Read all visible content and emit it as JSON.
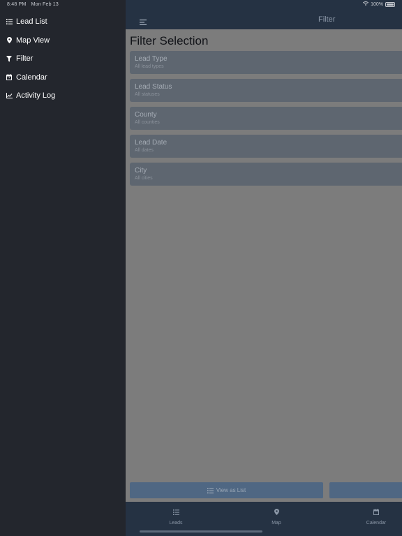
{
  "status_bar": {
    "time": "8:48 PM",
    "date": "Mon Feb 13",
    "battery": "100%"
  },
  "sidebar": {
    "items": [
      {
        "label": "Lead List",
        "icon": "list-icon"
      },
      {
        "label": "Map View",
        "icon": "map-pin-icon"
      },
      {
        "label": "Filter",
        "icon": "funnel-icon"
      },
      {
        "label": "Calendar",
        "icon": "calendar-icon"
      },
      {
        "label": "Activity Log",
        "icon": "line-chart-icon"
      }
    ]
  },
  "navbar": {
    "title": "Filter",
    "menu_icon": "hamburger-icon"
  },
  "main": {
    "page_title": "Filter Selection",
    "filters": [
      {
        "title": "Lead Type",
        "value": "All lead types"
      },
      {
        "title": "Lead Status",
        "value": "All statuses"
      },
      {
        "title": "County",
        "value": "All counties"
      },
      {
        "title": "Lead Date",
        "value": "All dates"
      },
      {
        "title": "City",
        "value": "All cities"
      }
    ],
    "view_list_button": "View as List"
  },
  "tabbar": {
    "tabs": [
      {
        "label": "Leads",
        "icon": "list-icon"
      },
      {
        "label": "Map",
        "icon": "map-pin-icon"
      },
      {
        "label": "Calendar",
        "icon": "calendar-icon"
      }
    ]
  },
  "colors": {
    "sidebar_bg": "#23262d",
    "navbar_bg": "#253243",
    "overlay_bg": "#7c7c7c",
    "card_bg": "#5e6670",
    "button_bg": "#4f6783"
  }
}
